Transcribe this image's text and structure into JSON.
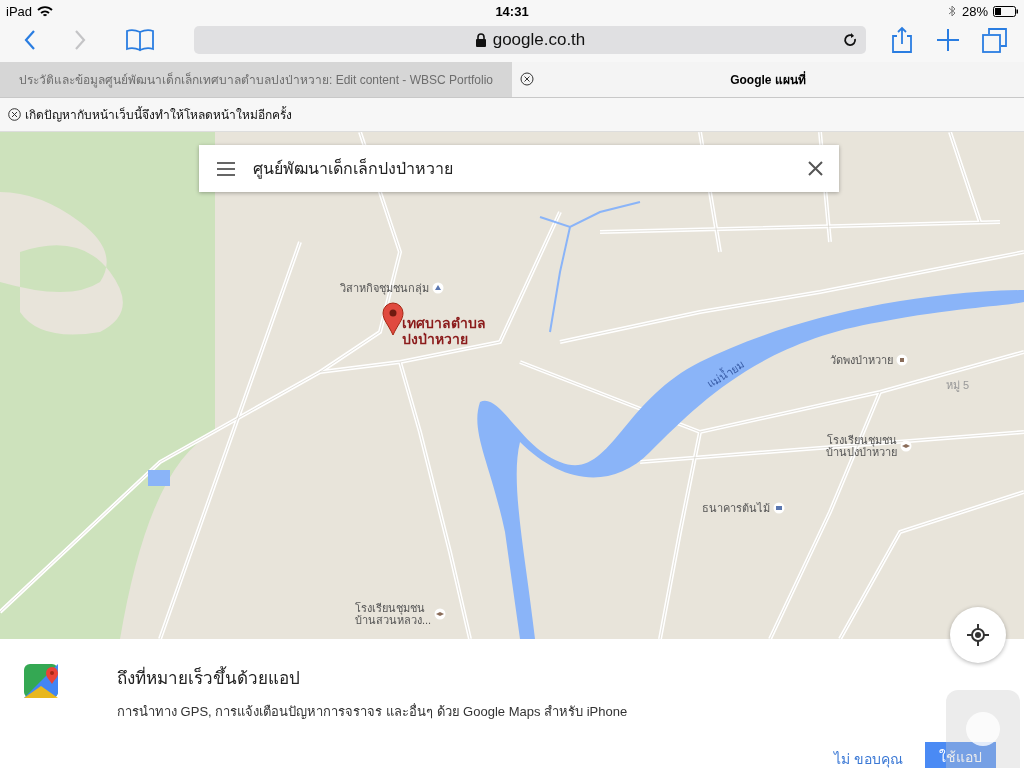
{
  "status_bar": {
    "device": "iPad",
    "time": "14:31",
    "battery": "28%"
  },
  "toolbar": {
    "url": "google.co.th"
  },
  "tabs": [
    {
      "title": "ประวัติและข้อมูลศูนย์พัฒนาเด็กเล็กเทศบาลตำบลปงป่าหวาย: Edit content - WBSC Portfolio",
      "selected": false
    },
    {
      "title": "Google แผนที่",
      "selected": true
    }
  ],
  "error_bar": {
    "message": "เกิดปัญหากับหน้าเว็บนี้จึงทำให้โหลดหน้าใหม่อีกครั้ง"
  },
  "map": {
    "search": {
      "value": "ศูนย์พัฒนาเด็กเล็กปงป่าหวาย"
    },
    "labels": [
      {
        "text": "วิสาหกิจชุมชนกลุ่ม",
        "kind": "place"
      },
      {
        "text": "เทศบาลตำบล\nปงป่าหวาย",
        "kind": "marker"
      },
      {
        "text": "แม่น้ำยม",
        "kind": "river"
      },
      {
        "text": "วัดพงป่าหวาย",
        "kind": "temple"
      },
      {
        "text": "หมู่ 5",
        "kind": "area"
      },
      {
        "text": "โรงเรียนชุมชน\nบ้านปงป่าหวาย",
        "kind": "school"
      },
      {
        "text": "ธนาคารต้นไม้",
        "kind": "bank"
      },
      {
        "text": "โรงเรียนชุมชน\nบ้านสวนหลวง...",
        "kind": "school"
      }
    ]
  },
  "banner": {
    "title": "ถึงที่หมายเร็วขึ้นด้วยแอป",
    "text": "การนำทาง GPS, การแจ้งเตือนปัญหาการจราจร และอื่นๆ ด้วย Google Maps สำหรับ iPhone",
    "buttons": [
      {
        "label": "ไม่ ขอบคุณ",
        "kind": "link"
      },
      {
        "label": "ใช้แอป",
        "kind": "primary"
      }
    ]
  }
}
